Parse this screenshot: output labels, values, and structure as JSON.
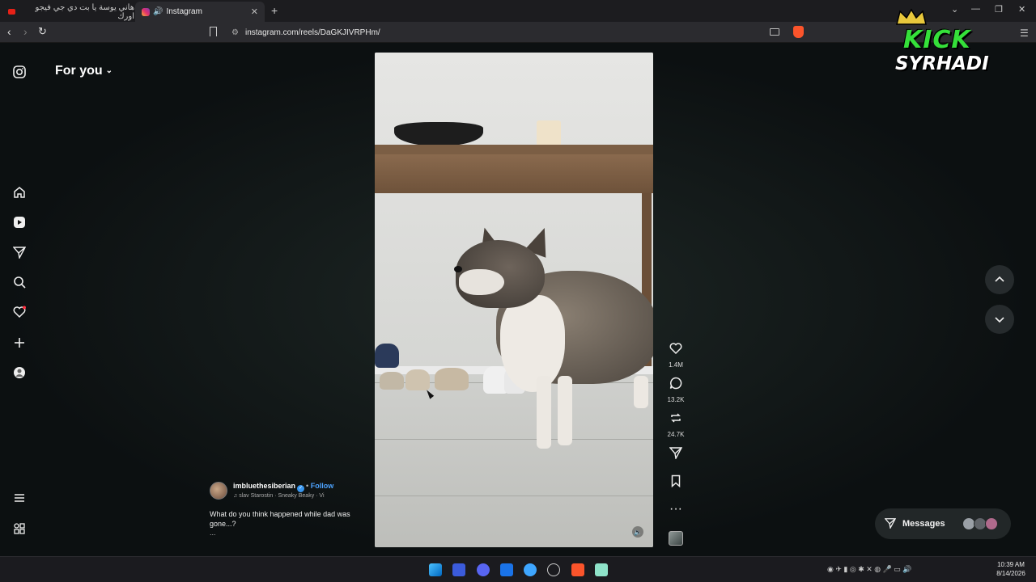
{
  "browser": {
    "tabs": [
      {
        "label": "هاني يوسة يا بت دي جي فيجو اورك",
        "active": false
      },
      {
        "label": "Instagram",
        "active": true
      }
    ],
    "url": "instagram.com/reels/DaGKJIVRPHm/"
  },
  "instagram": {
    "feed_title": "For you",
    "sidebar": [
      "instagram-logo",
      "home-icon",
      "reels-icon",
      "direct-icon",
      "search-icon",
      "notifications-icon",
      "create-icon",
      "profile-icon",
      "more-icon",
      "also-from-meta-icon"
    ],
    "reel": {
      "username": "imbluethesiberian",
      "follow_label": "Follow",
      "audio": "slav Starostin · Sneaky Beaky · Vi",
      "description": "What do you think happened while dad was gone...?",
      "more": "...",
      "likes": "1.4M",
      "comments": "13.2K",
      "reposts": "24.7K"
    },
    "messages_label": "Messages"
  },
  "overlay": {
    "line1": "KICK",
    "line2": "SYRHADI",
    "brand_color": "#35e03a"
  },
  "taskbar": {
    "time": "10:39 AM",
    "date": "8/14/2026"
  }
}
